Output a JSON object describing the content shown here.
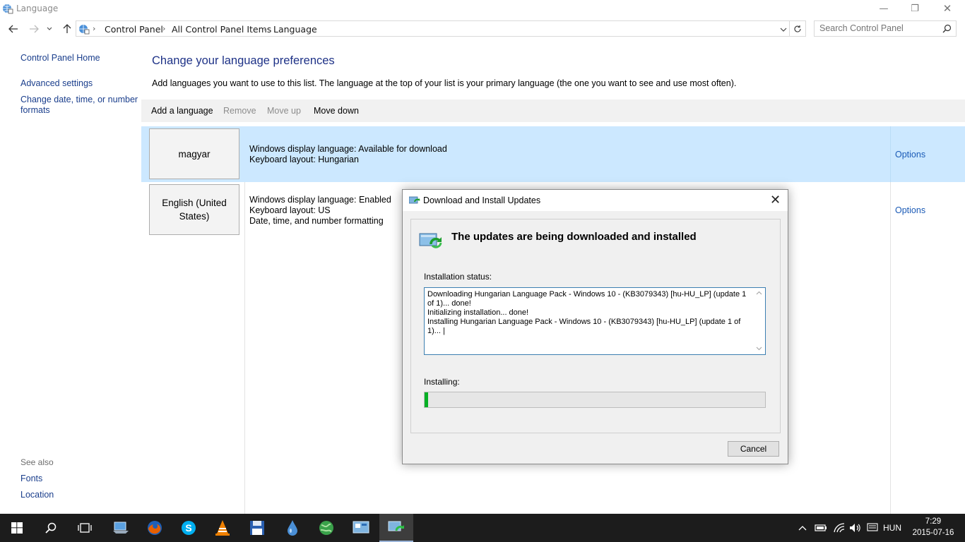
{
  "window": {
    "title": "Language",
    "minimize": "—",
    "restore": "❐",
    "close": "✕"
  },
  "address": {
    "crumbs": [
      "Control Panel",
      "All Control Panel Items",
      "Language"
    ],
    "search_placeholder": "Search Control Panel"
  },
  "sidebar": {
    "home": "Control Panel Home",
    "advanced": "Advanced settings",
    "date_line1": "Change date, time, or number",
    "date_line2": "formats",
    "see_also": "See also",
    "fonts": "Fonts",
    "location": "Location"
  },
  "main": {
    "heading": "Change your language preferences",
    "description": "Add languages you want to use to this list. The language at the top of your list is your primary language (the one you want to see and use most often).",
    "toolbar": {
      "add": "Add a language",
      "remove": "Remove",
      "move_up": "Move up",
      "move_down": "Move down"
    },
    "languages": [
      {
        "name": "magyar",
        "line1": "Windows display language: Available for download",
        "line2": "Keyboard layout: Hungarian",
        "line3": "",
        "options": "Options",
        "selected": true
      },
      {
        "name_line1": "English (United",
        "name_line2": "States)",
        "line1": "Windows display language: Enabled",
        "line2": "Keyboard layout: US",
        "line3": "Date, time, and number formatting",
        "options": "Options",
        "selected": false
      }
    ]
  },
  "dialog": {
    "title": "Download and Install Updates",
    "close": "✕",
    "headline": "The updates are being downloaded and installed",
    "status_label": "Installation status:",
    "status_text": "Downloading Hungarian Language Pack - Windows 10 - (KB3079343) [hu-HU_LP] (update 1 of 1)... done!\nInitializing installation... done!\nInstalling Hungarian Language Pack - Windows 10 - (KB3079343) [hu-HU_LP] (update 1 of 1)... |",
    "installing_label": "Installing:",
    "progress_fraction": 0.01,
    "cancel": "Cancel"
  },
  "taskbar": {
    "language": "HUN",
    "time": "7:29",
    "date": "2015-07-16"
  },
  "colors": {
    "link": "#1a3e8c",
    "heading": "#1e3287",
    "selection": "#cce8ff",
    "progress": "#06b025",
    "taskbar": "#1c1c1c"
  }
}
